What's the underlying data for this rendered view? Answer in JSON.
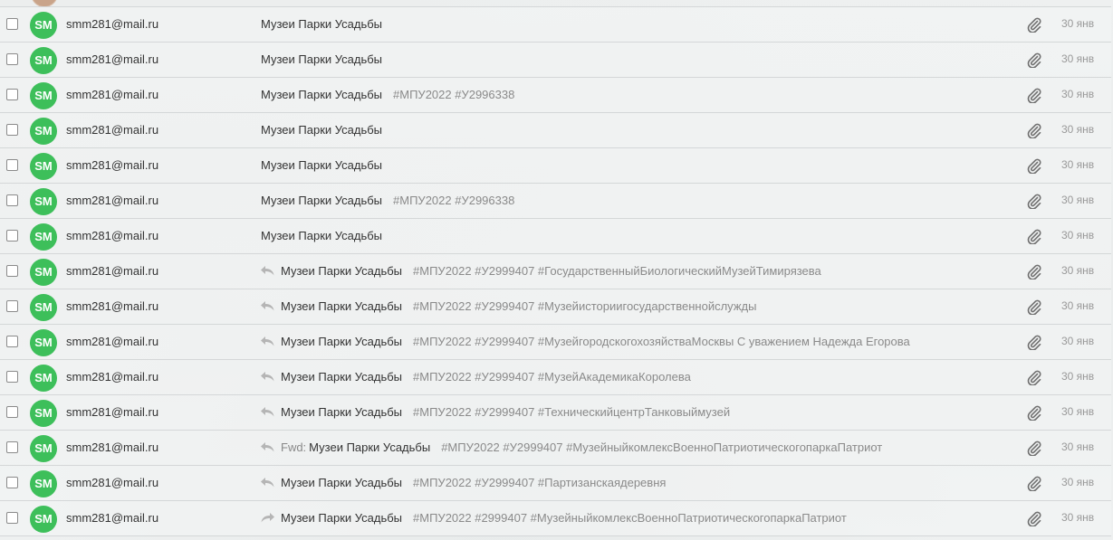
{
  "colors": {
    "avatar_bg": "#3dbf5a",
    "text": "#333333",
    "snippet": "#8a8a8a",
    "date": "#999999"
  },
  "messages": [
    {
      "initials": "SM",
      "sender": "smm281@mail.ru",
      "icon": "",
      "prefix": "",
      "subject": "Музеи Парки Усадьбы",
      "snippet": "",
      "date": "30 янв",
      "attachment": true
    },
    {
      "initials": "SM",
      "sender": "smm281@mail.ru",
      "icon": "",
      "prefix": "",
      "subject": "Музеи Парки Усадьбы",
      "snippet": "",
      "date": "30 янв",
      "attachment": true
    },
    {
      "initials": "SM",
      "sender": "smm281@mail.ru",
      "icon": "",
      "prefix": "",
      "subject": "Музеи Парки Усадьбы",
      "snippet": "#МПУ2022 #У2996338",
      "date": "30 янв",
      "attachment": true
    },
    {
      "initials": "SM",
      "sender": "smm281@mail.ru",
      "icon": "",
      "prefix": "",
      "subject": "Музеи Парки Усадьбы",
      "snippet": "",
      "date": "30 янв",
      "attachment": true
    },
    {
      "initials": "SM",
      "sender": "smm281@mail.ru",
      "icon": "",
      "prefix": "",
      "subject": "Музеи Парки Усадьбы",
      "snippet": "",
      "date": "30 янв",
      "attachment": true
    },
    {
      "initials": "SM",
      "sender": "smm281@mail.ru",
      "icon": "",
      "prefix": "",
      "subject": "Музеи Парки Усадьбы",
      "snippet": "#МПУ2022 #У2996338",
      "date": "30 янв",
      "attachment": true
    },
    {
      "initials": "SM",
      "sender": "smm281@mail.ru",
      "icon": "",
      "prefix": "",
      "subject": "Музеи Парки Усадьбы",
      "snippet": "",
      "date": "30 янв",
      "attachment": true
    },
    {
      "initials": "SM",
      "sender": "smm281@mail.ru",
      "icon": "reply-icon",
      "prefix": "",
      "subject": "Музеи Парки Усадьбы",
      "snippet": "#МПУ2022 #У2999407 #ГосударственныйБиологическийМузейТимирязева",
      "date": "30 янв",
      "attachment": true
    },
    {
      "initials": "SM",
      "sender": "smm281@mail.ru",
      "icon": "reply-icon",
      "prefix": "",
      "subject": "Музеи Парки Усадьбы",
      "snippet": "#МПУ2022 #У2999407 #Музейисториигосударственнойслужды",
      "date": "30 янв",
      "attachment": true
    },
    {
      "initials": "SM",
      "sender": "smm281@mail.ru",
      "icon": "reply-icon",
      "prefix": "",
      "subject": "Музеи Парки Усадьбы",
      "snippet": "#МПУ2022 #У2999407 #МузейгородскогохозяйстваМосквы С уважением Надежда Егорова",
      "date": "30 янв",
      "attachment": true
    },
    {
      "initials": "SM",
      "sender": "smm281@mail.ru",
      "icon": "reply-icon",
      "prefix": "",
      "subject": "Музеи Парки Усадьбы",
      "snippet": "#МПУ2022 #У2999407 #МузейАкадемикаКоролева",
      "date": "30 янв",
      "attachment": true
    },
    {
      "initials": "SM",
      "sender": "smm281@mail.ru",
      "icon": "reply-icon",
      "prefix": "",
      "subject": "Музеи Парки Усадьбы",
      "snippet": "#МПУ2022 #У2999407 #ТехническийцентрТанковыймузей",
      "date": "30 янв",
      "attachment": true
    },
    {
      "initials": "SM",
      "sender": "smm281@mail.ru",
      "icon": "reply-icon",
      "prefix": "Fwd:",
      "subject": "Музеи Парки Усадьбы",
      "snippet": "#МПУ2022 #У2999407 #МузейныйкомлексВоенноПатриотическогопаркаПатриот",
      "date": "30 янв",
      "attachment": true
    },
    {
      "initials": "SM",
      "sender": "smm281@mail.ru",
      "icon": "reply-icon",
      "prefix": "",
      "subject": "Музеи Парки Усадьбы",
      "snippet": "#МПУ2022 #У2999407 #Партизанскаядеревня",
      "date": "30 янв",
      "attachment": true
    },
    {
      "initials": "SM",
      "sender": "smm281@mail.ru",
      "icon": "forward-icon",
      "prefix": "",
      "subject": "Музеи Парки Усадьбы",
      "snippet": "#МПУ2022 #2999407 #МузейныйкомлексВоенноПатриотическогопаркаПатриот",
      "date": "30 янв",
      "attachment": true
    }
  ]
}
